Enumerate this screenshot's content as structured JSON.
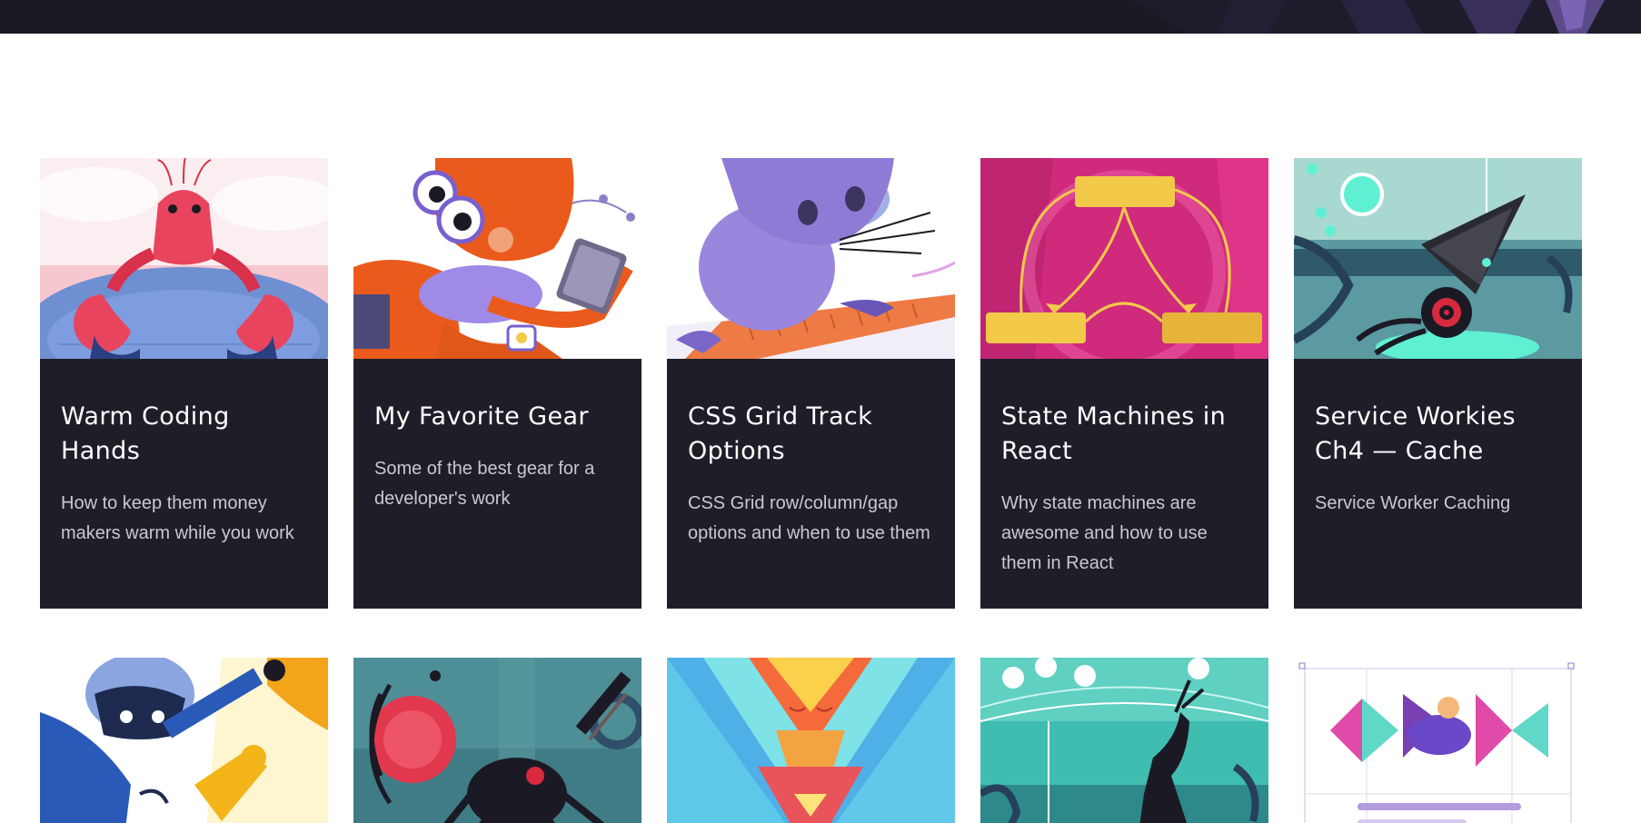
{
  "cards": [
    {
      "title": "Warm Coding Hands",
      "description": "How to keep them money makers warm while you work",
      "illustration": "lobster-hands"
    },
    {
      "title": "My Favorite Gear",
      "description": "Some of the best gear for a developer's work",
      "illustration": "fox-with-glasses"
    },
    {
      "title": "CSS Grid Track Options",
      "description": "CSS Grid row/column/gap options and when to use them",
      "illustration": "mouse-on-ruler"
    },
    {
      "title": "State Machines in React",
      "description": "Why state machines are awesome and how to use them in React",
      "illustration": "state-diagram"
    },
    {
      "title": "Service Workies Ch4 — Cache",
      "description": "Service Worker Caching",
      "illustration": "drill-creature"
    },
    {
      "illustration": "raccoon-with-key"
    },
    {
      "illustration": "red-spider-robot"
    },
    {
      "illustration": "geometric-fox"
    },
    {
      "illustration": "deer-silhouette"
    },
    {
      "illustration": "grid-shapes"
    }
  ],
  "colors": {
    "card_background": "#1f1e28",
    "header_background": "#1b1a24",
    "title_text": "#ffffff",
    "description_text": "#c9c8cf"
  }
}
